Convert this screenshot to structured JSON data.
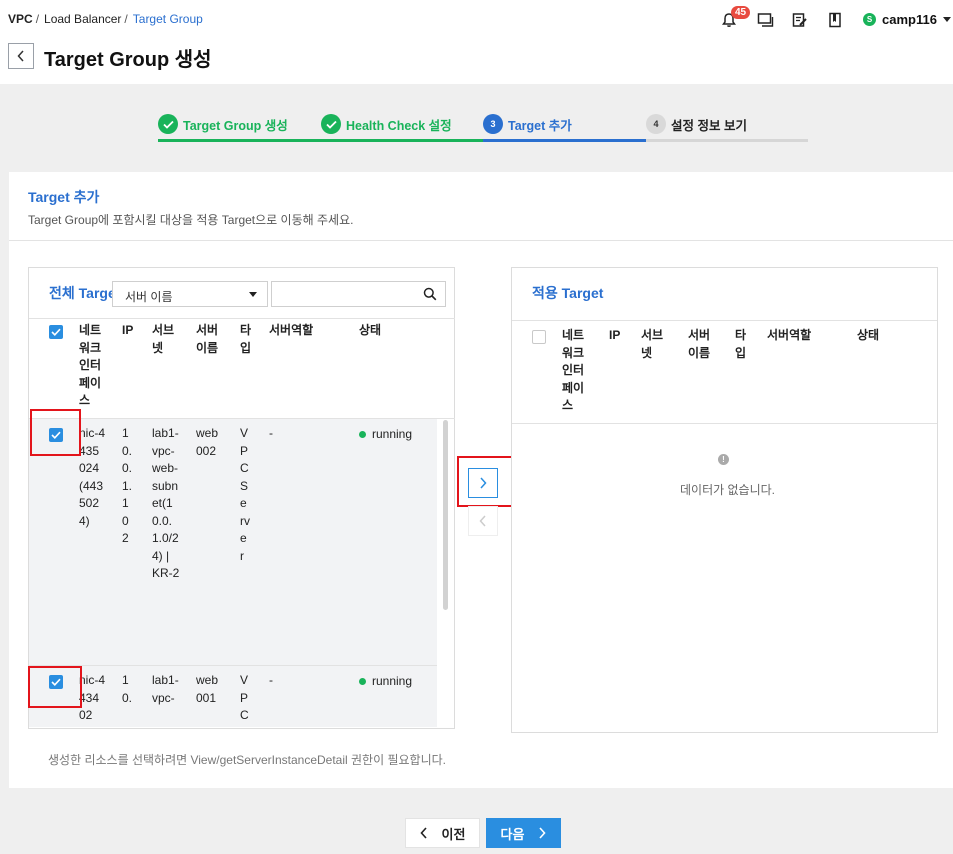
{
  "breadcrumb": {
    "vpc": "VPC",
    "lb": "Load Balancer",
    "current": "Target Group",
    "sep": "/"
  },
  "header": {
    "title": "Target Group 생성",
    "notification_count": "45",
    "user": "camp116",
    "user_initial": "S"
  },
  "steps": [
    {
      "num": "",
      "label": "Target Group 생성",
      "state": "done"
    },
    {
      "num": "",
      "label": "Health Check 설정",
      "state": "done"
    },
    {
      "num": "3",
      "label": "Target 추가",
      "state": "active"
    },
    {
      "num": "4",
      "label": "설정 정보 보기",
      "state": "pending"
    }
  ],
  "section": {
    "title": "Target 추가",
    "description": "Target Group에 포함시킬 대상을 적용 Target으로 이동해 주세요."
  },
  "left_panel": {
    "title": "전체 Targe",
    "filter_select": "서버 이름",
    "search_placeholder": "",
    "columns": {
      "nic": "네트워크인터페이스",
      "ip": "IP",
      "subnet": "서브넷",
      "server_name": "서버이름",
      "type": "타입",
      "role": "서버역할",
      "status": "상태"
    },
    "rows": [
      {
        "nic": "nic-4435024(4435024)",
        "ip": "10.0.1.102",
        "subnet": "lab1-vpc-web-subnet(10.0.1.0/24) | KR-2",
        "server_name": "web002",
        "type": "VPCServer",
        "role": "-",
        "status": "running",
        "checked": true
      },
      {
        "nic": "nic-443402",
        "ip": "10.",
        "subnet": "lab1-vpc-",
        "server_name": "web001",
        "type": "VPC",
        "role": "-",
        "status": "running",
        "checked": true
      }
    ]
  },
  "right_panel": {
    "title": "적용 Target",
    "columns": {
      "nic": "네트워크인터페이스",
      "ip": "IP",
      "subnet": "서브넷",
      "server_name": "서버이름",
      "type": "타입",
      "role": "서버역할",
      "status": "상태"
    },
    "empty_text": "데이터가 없습니다."
  },
  "note": "생성한 리소스를 선택하려면 View/getServerInstanceDetail 권한이 필요합니다.",
  "footer": {
    "prev": "이전",
    "next": "다음"
  },
  "colors": {
    "accent": "#2a6fcf",
    "primary_button": "#2a8ee0",
    "success": "#19b35a",
    "highlight": "#e3141b"
  }
}
